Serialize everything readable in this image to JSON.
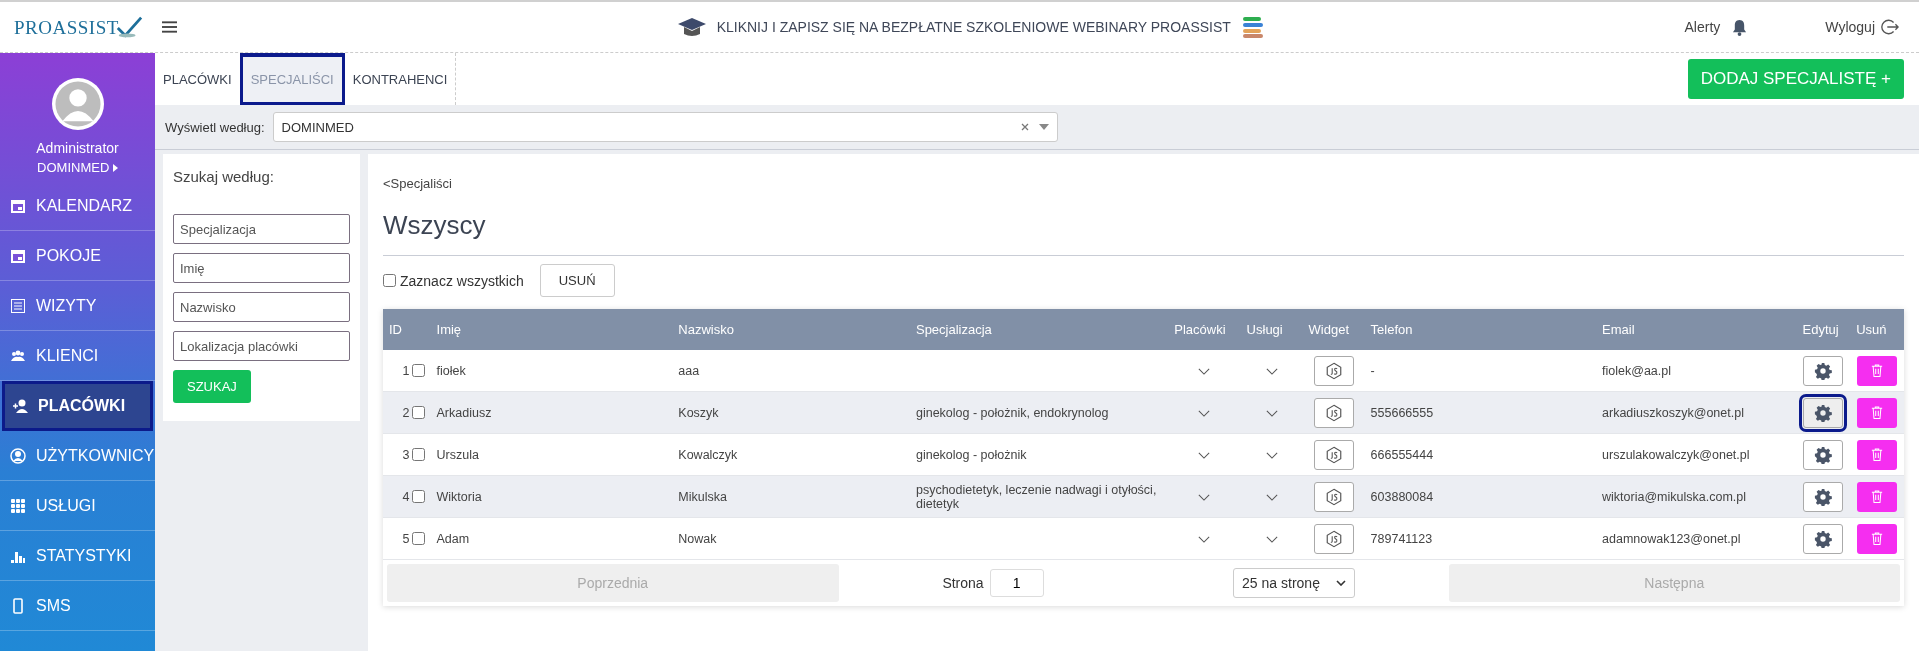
{
  "header": {
    "logo": "PROASSIST",
    "banner": "KLIKNIJ I ZAPISZ SIĘ NA BEZPŁATNE SZKOLENIOWE WEBINARY PROASSIST",
    "alerts": "Alerty",
    "logout": "Wyloguj"
  },
  "user": {
    "name": "Administrator",
    "company": "DOMINMED"
  },
  "sidebar": {
    "items": [
      {
        "label": "KALENDARZ",
        "selected": false
      },
      {
        "label": "POKOJE",
        "selected": false
      },
      {
        "label": "WIZYTY",
        "selected": false
      },
      {
        "label": "KLIENCI",
        "selected": false
      },
      {
        "label": "PLACÓWKI",
        "selected": true
      },
      {
        "label": "UŻYTKOWNICY",
        "selected": false
      },
      {
        "label": "USŁUGI",
        "selected": false
      },
      {
        "label": "STATYSTYKI",
        "selected": false
      },
      {
        "label": "SMS",
        "selected": false
      }
    ]
  },
  "tabs": [
    {
      "label": "PLACÓWKI",
      "selected": false
    },
    {
      "label": "SPECJALIŚCI",
      "selected": true
    },
    {
      "label": "KONTRAHENCI",
      "selected": false
    }
  ],
  "add_button": "DODAJ SPECJALISTĘ +",
  "filter": {
    "label": "Wyświetl według:",
    "value": "DOMINMED"
  },
  "search": {
    "title": "Szukaj według:",
    "fields": [
      {
        "placeholder": "Specjalizacja"
      },
      {
        "placeholder": "Imię"
      },
      {
        "placeholder": "Nazwisko"
      },
      {
        "placeholder": "Lokalizacja placówki"
      }
    ],
    "button": "SZUKAJ"
  },
  "breadcrumb": "<Specjaliści",
  "heading": "Wszyscy",
  "select_all": {
    "label": "Zaznacz wszystkich",
    "checked": false
  },
  "delete_button": "USUŃ",
  "table": {
    "columns": [
      "ID",
      "Imię",
      "Nazwisko",
      "Specjalizacja",
      "Placówki",
      "Usługi",
      "Widget",
      "Telefon",
      "Email",
      "Edytuj",
      "Usuń"
    ],
    "rows": [
      {
        "id": "1",
        "checked": false,
        "first_name": "fiołek",
        "last_name": "aaa",
        "phone": "-",
        "email": "fiolek@aa.pl",
        "edit_focused": false
      },
      {
        "id": "2",
        "checked": false,
        "first_name": "Arkadiusz",
        "last_name": "Koszyk",
        "specialization": "ginekolog - położnik, endokrynolog",
        "phone": "555666555",
        "email": "arkadiuszkoszyk@onet.pl",
        "edit_focused": true
      },
      {
        "id": "3",
        "checked": false,
        "first_name": "Urszula",
        "last_name": "Kowalczyk",
        "specialization": "ginekolog - położnik",
        "phone": "666555444",
        "email": "urszulakowalczyk@onet.pl",
        "edit_focused": false
      },
      {
        "id": "4",
        "checked": false,
        "first_name": "Wiktoria",
        "last_name": "Mikulska",
        "specialization": "psychodietetyk, leczenie nadwagi i otyłości, dietetyk",
        "phone": "603880084",
        "email": "wiktoria@mikulska.com.pl",
        "edit_focused": false
      },
      {
        "id": "5",
        "checked": false,
        "first_name": "Adam",
        "last_name": "Nowak",
        "phone": "789741123",
        "email": "adamnowak123@onet.pl",
        "edit_focused": false
      }
    ]
  },
  "pagination": {
    "previous": {
      "label": "Poprzednia",
      "disabled": true
    },
    "page_label": "Strona",
    "page": "1",
    "per_page": "25 na stronę",
    "next": {
      "label": "Następna",
      "disabled": true
    }
  }
}
